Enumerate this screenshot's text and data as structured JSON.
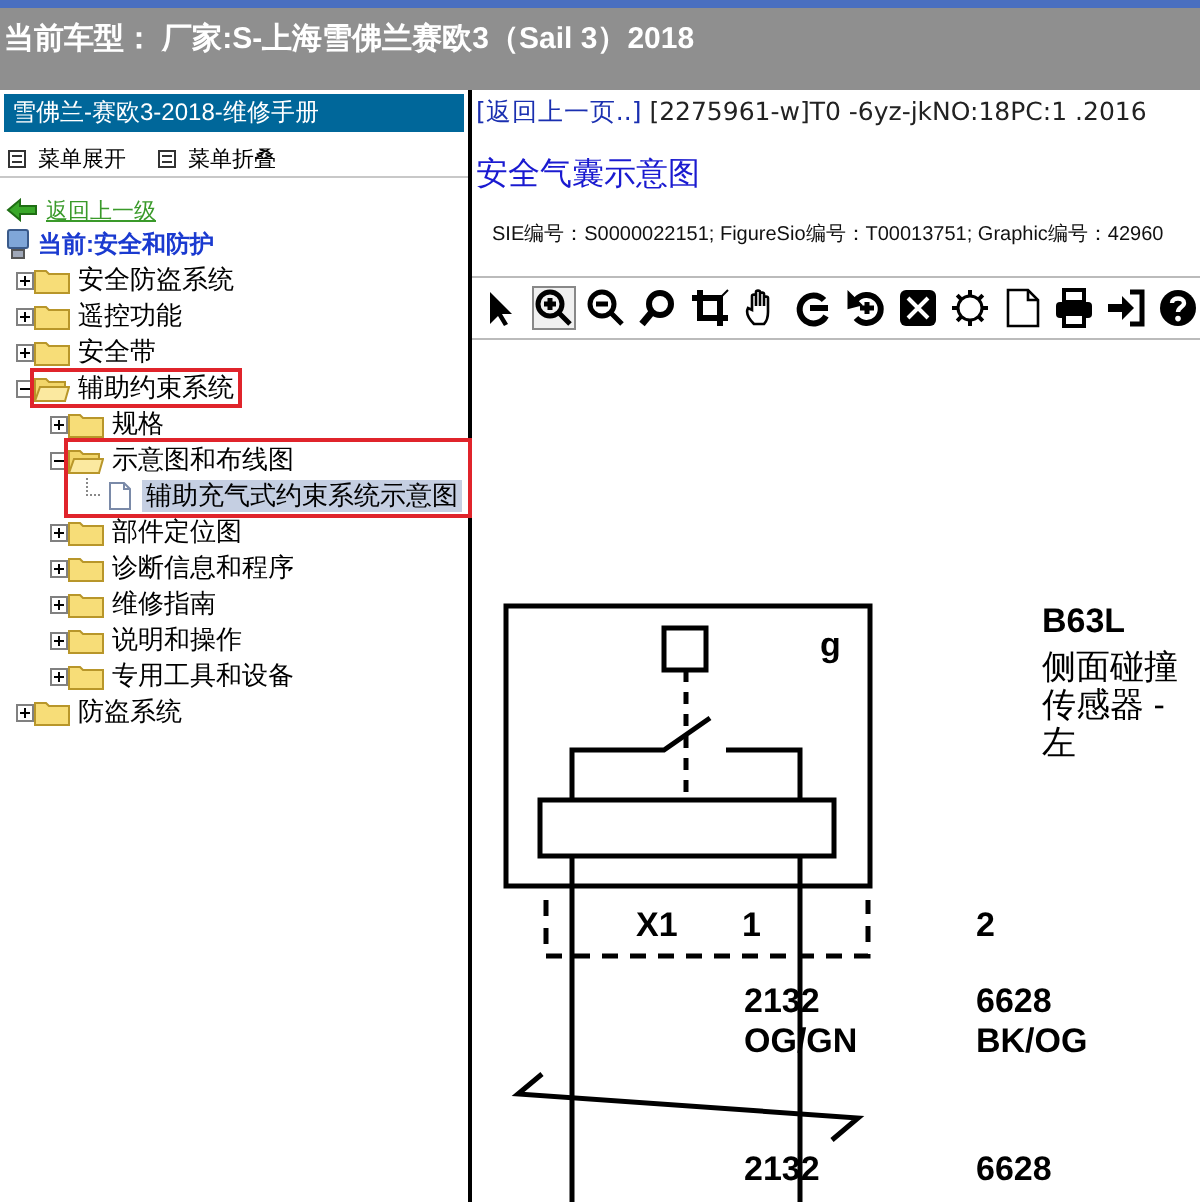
{
  "header": {
    "vehicle": "当前车型：  厂家:S-上海雪佛兰赛欧3（Sail 3）2018"
  },
  "sidebar": {
    "title": "雪佛兰-赛欧3-2018-维修手册",
    "menu": [
      {
        "label": "菜单展开"
      },
      {
        "label": "菜单折叠"
      }
    ],
    "back_link": "返回上一级",
    "current": "当前:安全和防护",
    "tree": [
      {
        "kind": "folder",
        "label": "安全防盗系统",
        "expanded": false,
        "selected": false
      },
      {
        "kind": "folder",
        "label": "遥控功能",
        "expanded": false,
        "selected": false
      },
      {
        "kind": "folder",
        "label": "安全带",
        "expanded": false,
        "selected": false
      },
      {
        "kind": "folder",
        "label": "辅助约束系统",
        "expanded": true,
        "selected": false,
        "framed": true,
        "children": [
          {
            "kind": "folder",
            "label": "规格",
            "expanded": false,
            "selected": false
          },
          {
            "kind": "folder",
            "label": "示意图和布线图",
            "expanded": true,
            "selected": false,
            "framed": true,
            "frame_includes_children": true,
            "children": [
              {
                "kind": "page",
                "label": "辅助充气式约束系统示意图",
                "selected": true
              }
            ]
          },
          {
            "kind": "folder",
            "label": "部件定位图",
            "expanded": false,
            "selected": false
          },
          {
            "kind": "folder",
            "label": "诊断信息和程序",
            "expanded": false,
            "selected": false
          },
          {
            "kind": "folder",
            "label": "维修指南",
            "expanded": false,
            "selected": false
          },
          {
            "kind": "folder",
            "label": "说明和操作",
            "expanded": false,
            "selected": false
          },
          {
            "kind": "folder",
            "label": "专用工具和设备",
            "expanded": false,
            "selected": false
          }
        ]
      },
      {
        "kind": "folder",
        "label": "防盗系统",
        "expanded": false,
        "selected": false
      }
    ]
  },
  "document": {
    "back_link": "[返回上一页..]",
    "reference": "[2275961-w]T0 -6yz-jkNO:18PC:1 .2016",
    "title": "安全气囊示意图",
    "meta": "SIE编号：S0000022151;  FigureSio编号：T00013751;  Graphic编号：42960",
    "toolbar": [
      {
        "kind": "pointer",
        "selected": false
      },
      {
        "kind": "zoom-in",
        "selected": true
      },
      {
        "kind": "zoom-out",
        "selected": false
      },
      {
        "kind": "search",
        "selected": false
      },
      {
        "kind": "crop",
        "selected": false
      },
      {
        "kind": "hand",
        "selected": false
      },
      {
        "kind": "rotate-right",
        "selected": false
      },
      {
        "kind": "rotate-left",
        "selected": false
      },
      {
        "kind": "fit",
        "selected": false
      },
      {
        "kind": "gear",
        "selected": false
      },
      {
        "kind": "page",
        "selected": false
      },
      {
        "kind": "print",
        "selected": false
      },
      {
        "kind": "export",
        "selected": false
      },
      {
        "kind": "help",
        "selected": false
      }
    ],
    "diagram": {
      "component_code": "B63L",
      "component_name": [
        "侧面碰撞",
        "传感器 -",
        "左"
      ],
      "pin_label": "g",
      "connector": "X1",
      "pins": [
        "1",
        "2"
      ],
      "wires": [
        {
          "number": "2132",
          "color_code": "OG/GN"
        },
        {
          "number": "6628",
          "color_code": "BK/OG"
        }
      ],
      "wires_after_break": [
        {
          "number": "2132"
        },
        {
          "number": "6628"
        }
      ]
    }
  }
}
